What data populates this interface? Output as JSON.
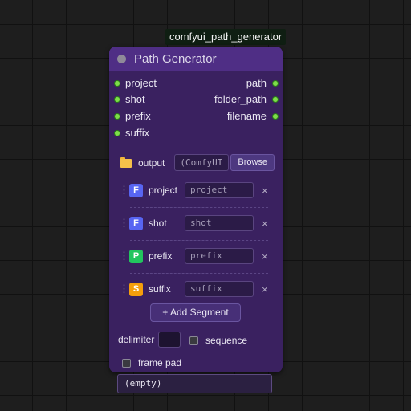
{
  "node": {
    "badge": "comfyui_path_generator",
    "title": "Path Generator",
    "inputs": [
      "project",
      "shot",
      "prefix",
      "suffix"
    ],
    "outputs": [
      "path",
      "folder_path",
      "filename"
    ],
    "output_label": "output",
    "output_value": "(ComfyUI",
    "browse_label": "Browse",
    "segments": [
      {
        "type": "F",
        "name": "project",
        "value": "project",
        "color": "#5865f2"
      },
      {
        "type": "F",
        "name": "shot",
        "value": "shot",
        "color": "#5865f2"
      },
      {
        "type": "P",
        "name": "prefix",
        "value": "prefix",
        "color": "#22c55e"
      },
      {
        "type": "S",
        "name": "suffix",
        "value": "suffix",
        "color": "#f59e0b"
      }
    ],
    "handle_glyph": "⋮",
    "remove_glyph": "×",
    "add_segment_label": "+ Add Segment",
    "delimiter_label": "delimiter",
    "delimiter_value": "_",
    "sequence_label": "sequence",
    "sequence_checked": false,
    "frame_pad_label": "frame pad",
    "frame_pad_checked": false,
    "result_text": "(empty)"
  },
  "icons": {
    "collapse": "collapse-dot-icon",
    "folder": "folder-icon",
    "drag": "drag-handle-icon",
    "remove": "close-icon"
  },
  "colors": {
    "node_body": "#3a2160",
    "node_header": "#4f2e85",
    "port": "#7ede4a",
    "segment_F": "#5865f2",
    "segment_P": "#22c55e",
    "segment_S": "#f59e0b"
  }
}
